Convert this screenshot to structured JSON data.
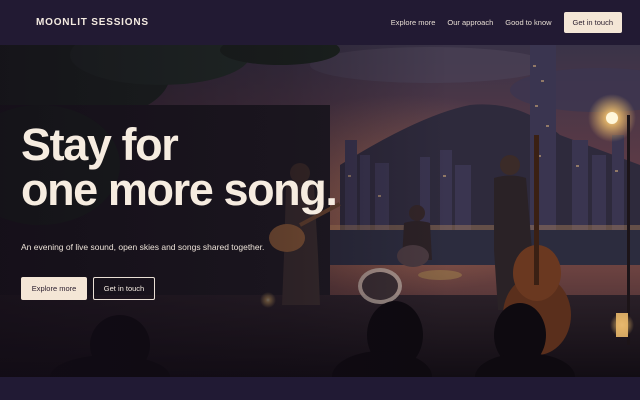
{
  "brand": {
    "name": "MOONLIT SESSIONS"
  },
  "nav": {
    "links": [
      "Explore more",
      "Our approach",
      "Good to know"
    ],
    "cta_label": "Get in touch"
  },
  "hero": {
    "headline_line1": "Stay for",
    "headline_line2": "one more song.",
    "subtitle": "An evening of live sound, open skies and songs shared together.",
    "primary_button": "Explore more",
    "secondary_button": "Get in touch",
    "image_description_icon": "concert-photo"
  },
  "colors": {
    "nav_bg": "#221a33",
    "accent_button": "#f4e6d6",
    "text_light": "#f6ece0",
    "bottom_strip": "#211a34"
  }
}
